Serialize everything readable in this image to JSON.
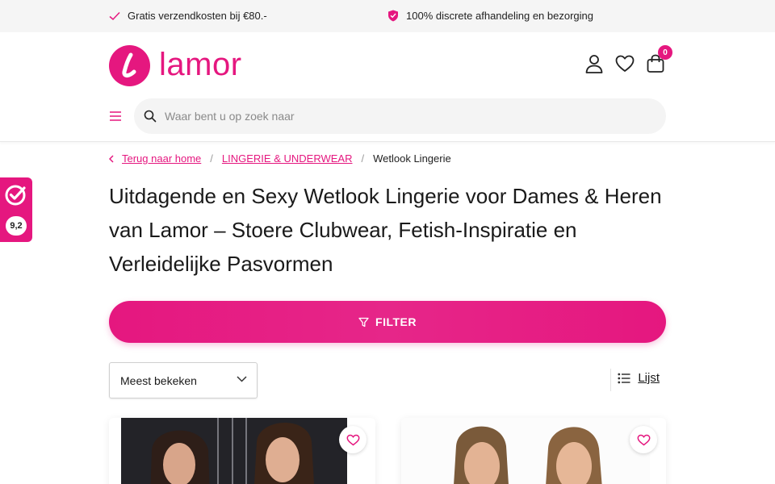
{
  "usp": {
    "shipping": "Gratis verzendkosten bij €80.-",
    "discreet": "100% discrete afhandeling en bezorging"
  },
  "brand": {
    "name": "lamor",
    "accent": "#e5177f"
  },
  "header": {
    "cart_count": "0",
    "search_placeholder": "Waar bent u op zoek naar"
  },
  "rating": {
    "score": "9,2"
  },
  "breadcrumb": {
    "back": "Terug naar home",
    "category": "LINGERIE & UNDERWEAR",
    "current": "Wetlook Lingerie"
  },
  "page": {
    "title": "Uitdagende en Sexy Wetlook Lingerie voor Dames & Heren van Lamor – Stoere Clubwear, Fetish-Inspiratie en Verleidelijke Pasvormen"
  },
  "toolbar": {
    "filter_label": "FILTER",
    "sort_selected": "Meest bekeken",
    "view_label": "Lijst"
  },
  "icons": {
    "usp_1": "check-icon",
    "usp_2": "shield-check-icon",
    "account": "user-icon",
    "wishlist": "heart-icon",
    "cart": "shopping-bag-icon",
    "menu": "hamburger-icon",
    "search": "search-icon",
    "filter": "funnel-icon",
    "list_view": "list-icon"
  }
}
